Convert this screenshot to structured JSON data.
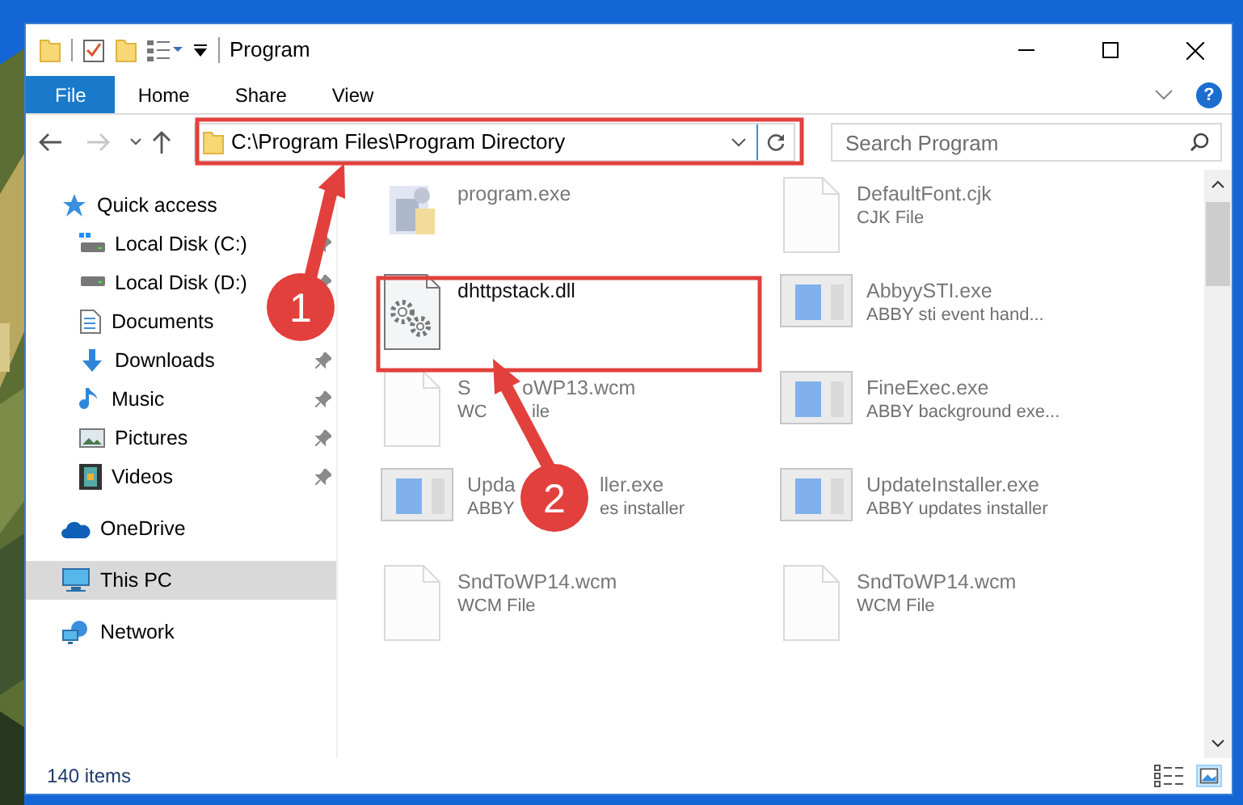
{
  "window": {
    "title": "Program"
  },
  "ribbon": {
    "tabs": [
      {
        "label": "File",
        "selected": true
      },
      {
        "label": "Home",
        "selected": false
      },
      {
        "label": "Share",
        "selected": false
      },
      {
        "label": "View",
        "selected": false
      }
    ],
    "help_glyph": "?"
  },
  "address_bar": {
    "path": "C:\\Program Files\\Program Directory",
    "forward_disabled": true
  },
  "search": {
    "placeholder": "Search Program"
  },
  "sidebar": {
    "items": [
      {
        "label": "Quick access",
        "selected": false,
        "children": [
          {
            "label": "Local Disk (C:)",
            "pinned": true
          },
          {
            "label": "Local Disk (D:)",
            "pinned": true
          },
          {
            "label": "Documents"
          },
          {
            "label": "Downloads",
            "pinned": true
          },
          {
            "label": "Music",
            "pinned": true
          },
          {
            "label": "Pictures",
            "pinned": true
          },
          {
            "label": "Videos",
            "pinned": true
          }
        ]
      },
      {
        "label": "OneDrive",
        "selected": false
      },
      {
        "label": "This PC",
        "selected": true
      },
      {
        "label": "Network",
        "selected": false
      }
    ]
  },
  "files": [
    {
      "name_parts": [
        "program.exe"
      ],
      "kind": "app",
      "dimmed": true
    },
    {
      "name_parts": [
        "DefaultFont.cjk"
      ],
      "description_parts": [
        "CJK File"
      ],
      "kind": "blank",
      "dimmed": true
    },
    {
      "name_parts": [
        "dhttpstack.dll"
      ],
      "kind": "dll",
      "dimmed": false
    },
    {
      "name_parts": [
        "AbbyySTI.exe"
      ],
      "description_parts": [
        "ABBY sti event hand..."
      ],
      "kind": "window",
      "dimmed": true
    },
    {
      "name_parts": [
        "S",
        "oWP13.wcm"
      ],
      "description_parts": [
        "WC",
        "ile"
      ],
      "kind": "blank",
      "dimmed": true
    },
    {
      "name_parts": [
        "FineExec.exe"
      ],
      "description_parts": [
        "ABBY background exe..."
      ],
      "kind": "window",
      "dimmed": true
    },
    {
      "name_parts": [
        "Upda",
        "ller.exe"
      ],
      "description_parts": [
        "ABBY",
        "es installer"
      ],
      "kind": "window",
      "dimmed": true
    },
    {
      "name_parts": [
        "UpdateInstaller.exe"
      ],
      "description_parts": [
        "ABBY updates installer"
      ],
      "kind": "window",
      "dimmed": true
    },
    {
      "name_parts": [
        "SndToWP14.wcm"
      ],
      "description_parts": [
        "WCM File"
      ],
      "kind": "blank",
      "dimmed": true
    },
    {
      "name_parts": [
        "SndToWP14.wcm"
      ],
      "description_parts": [
        "WCM File"
      ],
      "kind": "blank",
      "dimmed": true
    }
  ],
  "status_bar": {
    "item_count": "140 items"
  },
  "annotations": [
    {
      "number": "1"
    },
    {
      "number": "2"
    }
  ]
}
